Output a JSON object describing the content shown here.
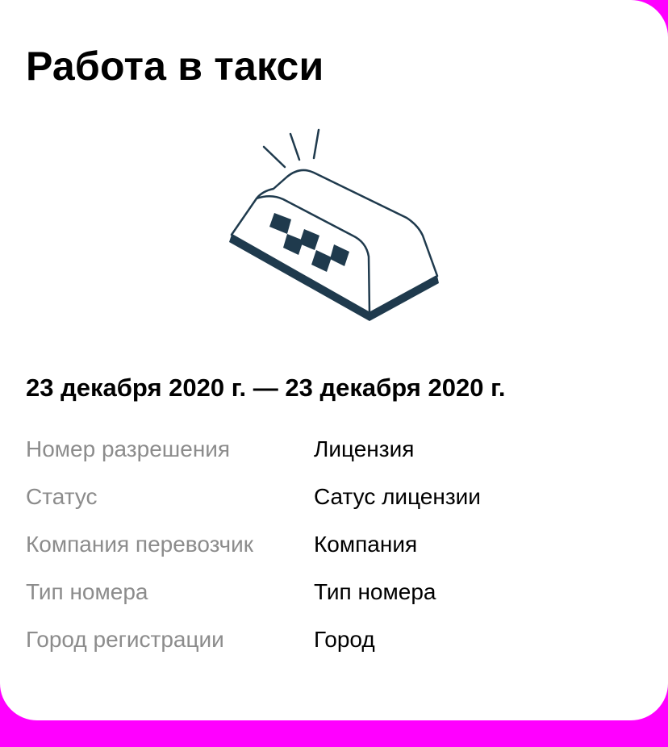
{
  "page": {
    "title": "Работа в такси",
    "dates": "23 декабря 2020 г. — 23 декабря 2020 г."
  },
  "illustration": {
    "icon": "taxi-roof-sign-icon",
    "colors": {
      "stroke": "#1f3a4d",
      "fill": "#ffffff"
    }
  },
  "details": [
    {
      "label": "Номер разрешения",
      "value": "Лицензия"
    },
    {
      "label": "Статус",
      "value": "Сатус лицензии"
    },
    {
      "label": "Компания перевозчик",
      "value": "Компания"
    },
    {
      "label": "Тип номера",
      "value": "Тип номера"
    },
    {
      "label": "Город регистрации",
      "value": "Город"
    }
  ],
  "colors": {
    "background_accent": "#ff00ff",
    "card": "#ffffff",
    "label": "#8c8c8c",
    "text": "#000000"
  }
}
